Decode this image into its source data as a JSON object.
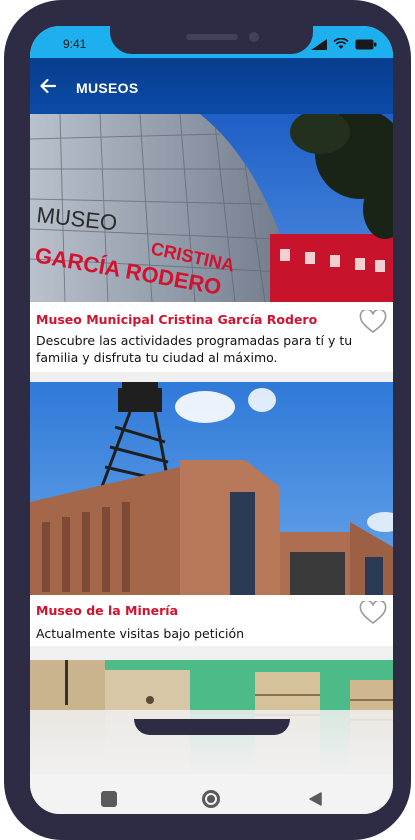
{
  "status": {
    "time": "9:41"
  },
  "header": {
    "title": "MUSEOS"
  },
  "cards": [
    {
      "title": "Museo Municipal Cristina García Rodero",
      "description": "Descubre las actividades programadas para tí y tu familia y disfruta tu ciudad al máximo.",
      "image_text_line1": "MUSEO",
      "image_text_line2": "CRISTINA",
      "image_text_line3": "GARCÍA RODERO"
    },
    {
      "title": "Museo de la Minería",
      "description": "Actualmente visitas bajo petición"
    },
    {
      "title": "",
      "description": ""
    }
  ],
  "colors": {
    "accent": "#d2122e",
    "appbar": "#0a4ba8",
    "statusbar": "#1eb0ee",
    "frame": "#2e2c45"
  },
  "icons": {
    "back": "back-arrow-icon",
    "favorite": "heart-outline-icon",
    "nav_recent": "square-icon",
    "nav_home": "circle-icon",
    "nav_back": "triangle-back-icon"
  }
}
